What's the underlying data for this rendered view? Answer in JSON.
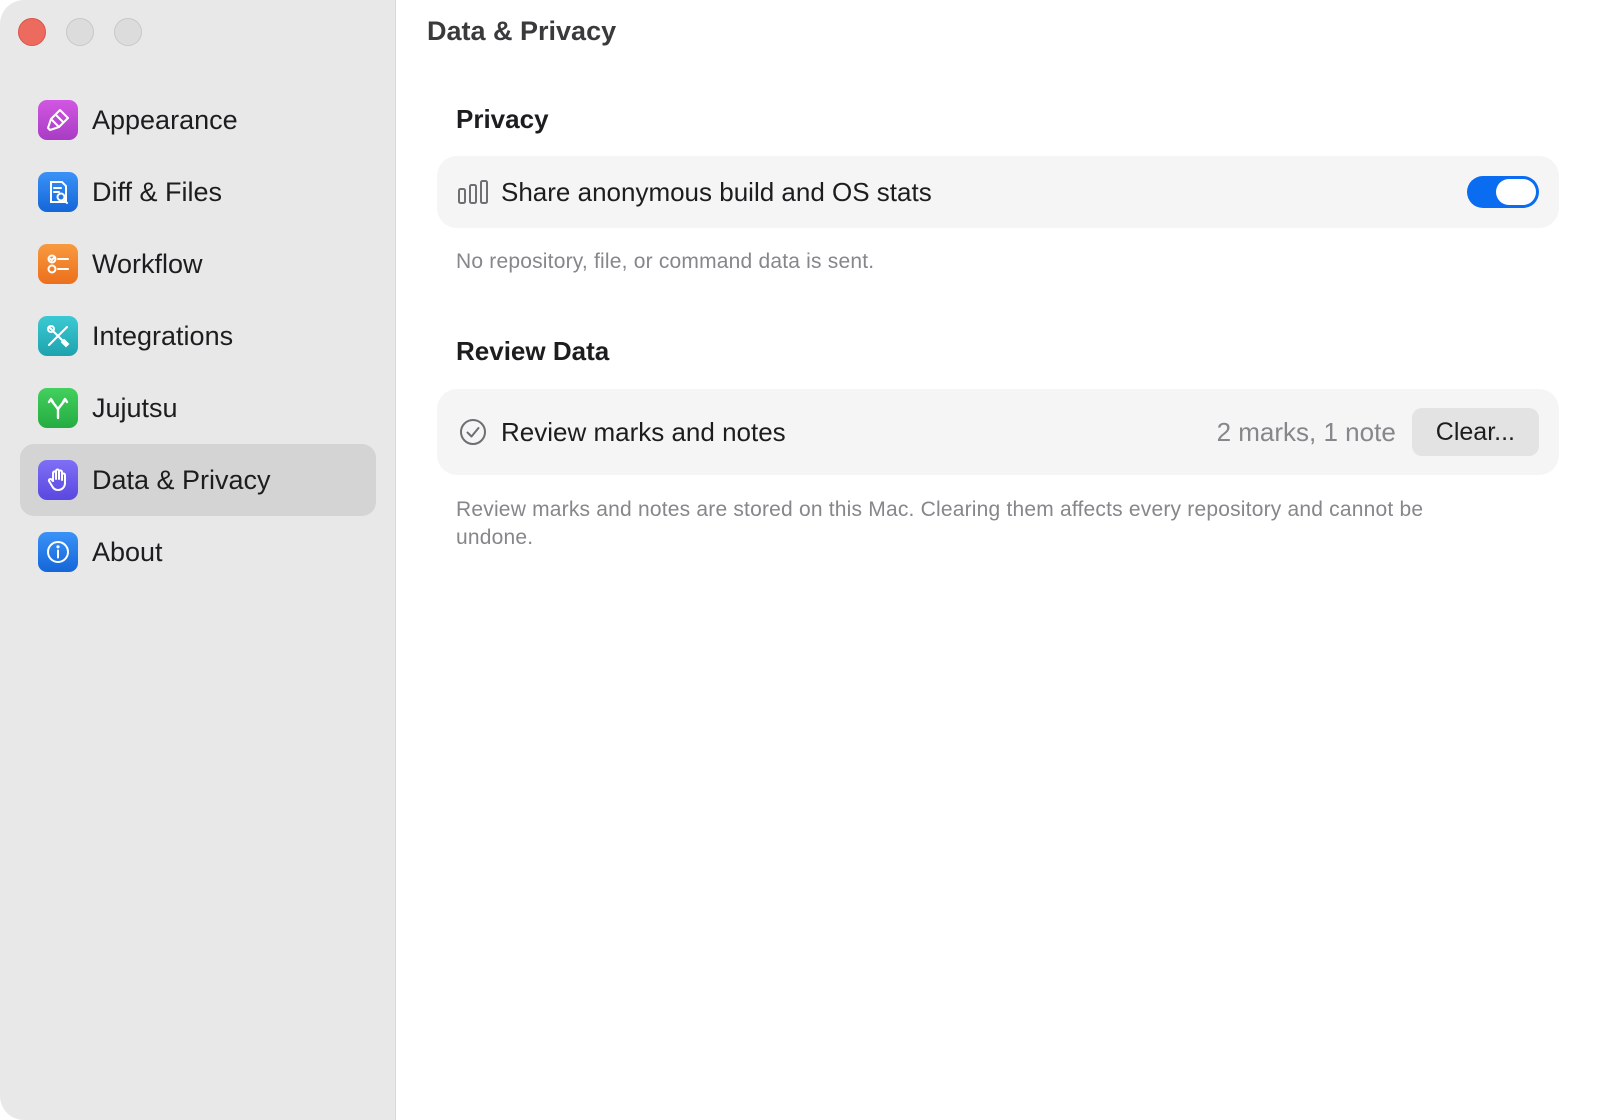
{
  "window": {
    "title": "Data & Privacy"
  },
  "sidebar": {
    "items": [
      {
        "label": "Appearance",
        "icon": "paintbrush-icon",
        "color": "#c74bd9",
        "selected": false
      },
      {
        "label": "Diff & Files",
        "icon": "document-magnifier-icon",
        "color": "#1d7df0",
        "selected": false
      },
      {
        "label": "Workflow",
        "icon": "checklist-icon",
        "color": "#f5862a",
        "selected": false
      },
      {
        "label": "Integrations",
        "icon": "wrench-screwdriver-icon",
        "color": "#27b7c2",
        "selected": false
      },
      {
        "label": "Jujutsu",
        "icon": "branch-fork-icon",
        "color": "#30c14e",
        "selected": false
      },
      {
        "label": "Data & Privacy",
        "icon": "raised-hand-icon",
        "color": "#6b5cf0",
        "selected": true
      },
      {
        "label": "About",
        "icon": "info-icon",
        "color": "#1d7df0",
        "selected": false
      }
    ]
  },
  "main": {
    "privacy": {
      "title": "Privacy",
      "row_label": "Share anonymous build and OS stats",
      "row_icon": "bar-chart-icon",
      "toggle_on": true,
      "footnote": "No repository, file, or command data is sent."
    },
    "review": {
      "title": "Review Data",
      "row_label": "Review marks and notes",
      "row_icon": "checkmark-circle-icon",
      "row_value": "2 marks, 1 note",
      "button_label": "Clear...",
      "footnote": "Review marks and notes are stored on this Mac. Clearing them affects every repository and cannot be undone."
    }
  },
  "colors": {
    "accent": "#0a6cf0",
    "sidebar_bg": "#e8e8e8",
    "card_bg": "#f5f5f5",
    "close_button": "#ec6a5e"
  }
}
